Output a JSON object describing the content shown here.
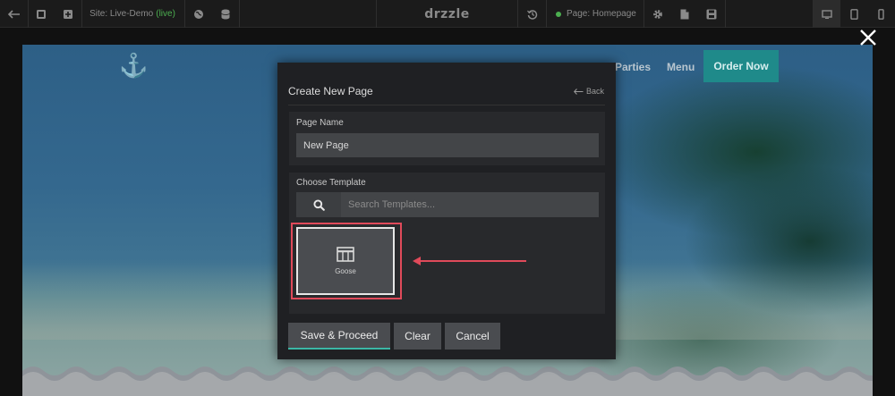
{
  "toolbar": {
    "site_label": "Site: Live-Demo",
    "site_status": "(live)",
    "logo": "drzzle",
    "page_label": "Page: Homepage"
  },
  "site_nav": {
    "links": [
      "Parties",
      "Menu"
    ],
    "order_button": "Order Now"
  },
  "modal": {
    "title": "Create New Page",
    "back_label": "Back",
    "page_name_label": "Page Name",
    "page_name_value": "New Page",
    "choose_template_label": "Choose Template",
    "search_placeholder": "Search Templates...",
    "templates": [
      {
        "name": "Goose",
        "selected": true
      }
    ],
    "buttons": {
      "save": "Save & Proceed",
      "clear": "Clear",
      "cancel": "Cancel"
    }
  },
  "colors": {
    "accent_teal": "#3bb8a6",
    "highlight_red": "#e04a5a",
    "live_green": "#4caf50",
    "order_button": "#1f8a8a"
  },
  "icons": [
    "arrow-left-icon",
    "layers-icon",
    "duplicate-icon",
    "globe-icon",
    "database-icon",
    "history-icon",
    "gear-icon",
    "file-icon",
    "save-icon",
    "desktop-icon",
    "tablet-icon",
    "mobile-icon",
    "anchor-icon",
    "search-icon",
    "template-icon",
    "close-icon"
  ]
}
